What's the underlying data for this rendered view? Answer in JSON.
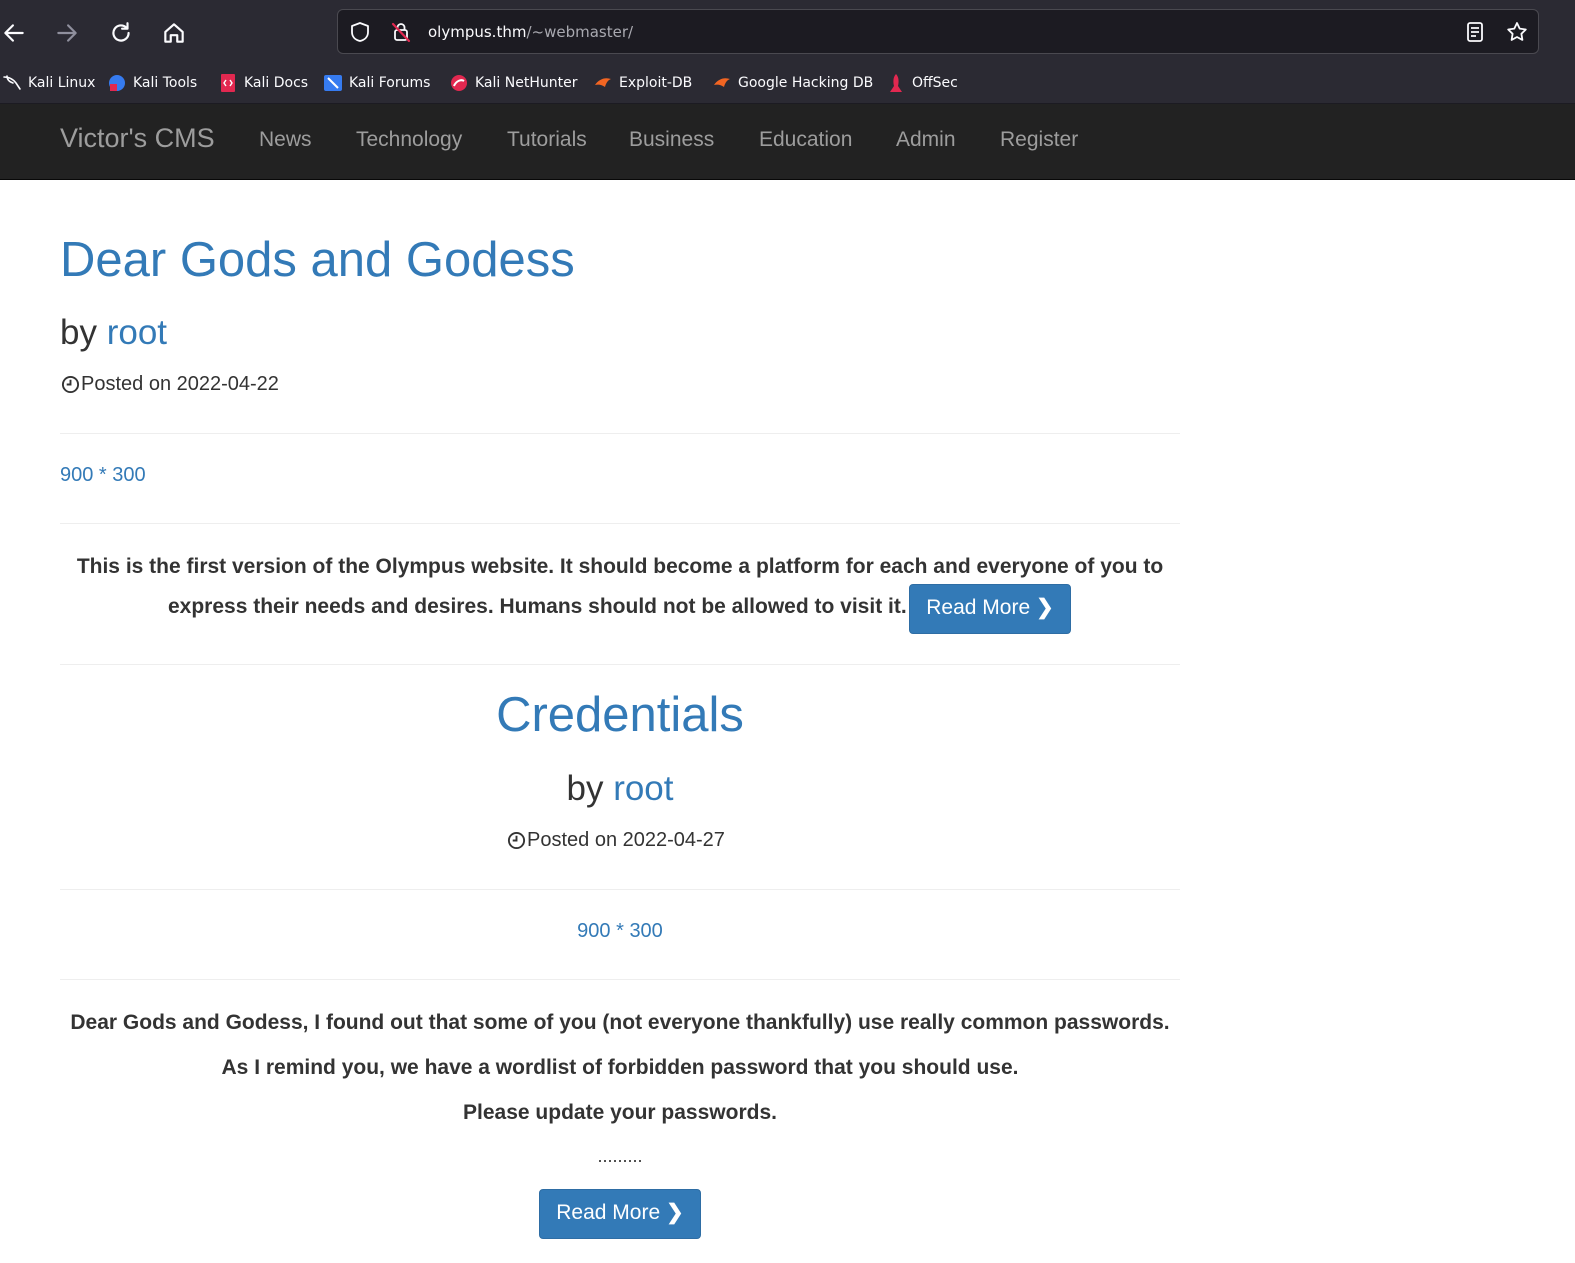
{
  "browser": {
    "url_host": "olympus.thm",
    "url_path": "/~webmaster/",
    "bookmarks": [
      {
        "label": "Kali Linux",
        "icon": "kali-dragon-icon"
      },
      {
        "label": "Kali Tools",
        "icon": "kali-tools-icon"
      },
      {
        "label": "Kali Docs",
        "icon": "kali-docs-icon"
      },
      {
        "label": "Kali Forums",
        "icon": "kali-forums-icon"
      },
      {
        "label": "Kali NetHunter",
        "icon": "kali-nethunter-icon"
      },
      {
        "label": "Exploit-DB",
        "icon": "exploit-db-icon"
      },
      {
        "label": "Google Hacking DB",
        "icon": "ghdb-icon"
      },
      {
        "label": "OffSec",
        "icon": "offsec-icon"
      }
    ]
  },
  "site": {
    "brand": "Victor's CMS",
    "nav": [
      "News",
      "Technology",
      "Tutorials",
      "Business",
      "Education",
      "Admin",
      "Register"
    ]
  },
  "posts": [
    {
      "title": "Dear Gods and Godess",
      "by_prefix": "by",
      "author": "root",
      "posted": "Posted on 2022-04-22",
      "image_placeholder": "900 * 300",
      "excerpt_lines": [
        "This is the first version of the Olympus website. It should become a platform for each and everyone of you to",
        "express their needs and desires. Humans should not be allowed to visit it."
      ],
      "read_more": "Read More"
    },
    {
      "title": "Credentials",
      "by_prefix": "by",
      "author": "root",
      "posted": "Posted on 2022-04-27",
      "image_placeholder": "900 * 300",
      "excerpt_lines": [
        "Dear Gods and Godess, I found out that some of you (not everyone thankfully) use really common passwords.",
        "As I remind you, we have a wordlist of forbidden password that you should use.",
        "Please update your passwords.",
        "........."
      ],
      "read_more": "Read More"
    }
  ],
  "colors": {
    "link": "#337ab7",
    "navbar_bg": "#222222",
    "browser_bg": "#2b2a33"
  }
}
